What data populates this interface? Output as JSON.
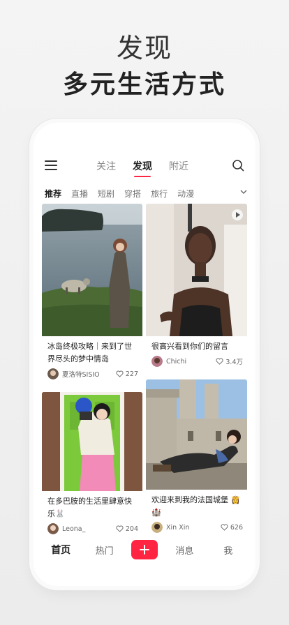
{
  "hero": {
    "title": "发现",
    "subtitle": "多元生活方式"
  },
  "header": {
    "tabs": [
      {
        "label": "关注",
        "active": false
      },
      {
        "label": "发现",
        "active": true
      },
      {
        "label": "附近",
        "active": false
      }
    ],
    "menu_icon": "hamburger-menu-icon",
    "search_icon": "search-icon"
  },
  "categories": [
    "推荐",
    "直播",
    "短剧",
    "穿搭",
    "旅行",
    "动漫"
  ],
  "feed": [
    {
      "title": "冰岛终极攻略｜来到了世界尽头的梦中情岛",
      "author": "夏洛特SISIO",
      "likes": "227",
      "is_video": false
    },
    {
      "title": "很高兴看到你们的留言",
      "author": "Chichi",
      "likes": "3.4万",
      "is_video": true
    },
    {
      "title": "在多巴胺的生活里肆意快乐🐰",
      "author": "Leona_",
      "likes": "204",
      "is_video": false
    },
    {
      "title": "欢迎来到我的法国城堡 👸🏰",
      "author": "Xin Xin",
      "likes": "626",
      "is_video": false
    }
  ],
  "bottom_nav": {
    "home": "首页",
    "hot": "热门",
    "messages": "消息",
    "me": "我"
  },
  "colors": {
    "accent": "#ff2442",
    "background": "#f2f2f2"
  }
}
